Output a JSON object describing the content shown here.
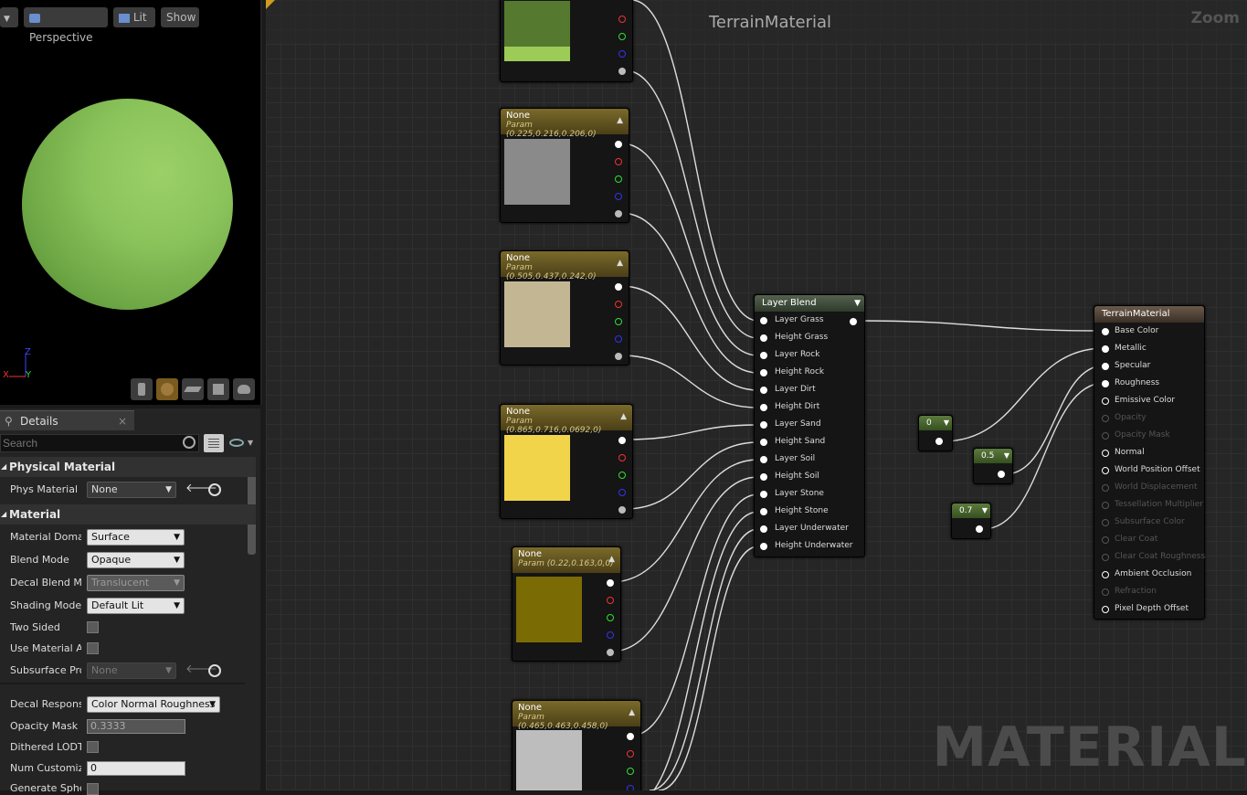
{
  "viewport": {
    "dropdown_icon": "chevron-down-icon",
    "perspective_label": "Perspective",
    "lit_label": "Lit",
    "show_label": "Show",
    "axis_z": "Z",
    "axis_x": "X",
    "axis_y": "Y"
  },
  "details": {
    "tab_label": "Details",
    "tab_close": "×",
    "search_placeholder": "Search",
    "sections": {
      "physical": "Physical Material",
      "material": "Material"
    },
    "props": {
      "phys_material": {
        "label": "Phys Material",
        "value": "None"
      },
      "material_domain": {
        "label": "Material Domai",
        "value": "Surface"
      },
      "blend_mode": {
        "label": "Blend Mode",
        "value": "Opaque"
      },
      "decal_blend": {
        "label": "Decal Blend Mo",
        "value": "Translucent"
      },
      "shading_model": {
        "label": "Shading Model",
        "value": "Default Lit"
      },
      "two_sided": {
        "label": "Two Sided"
      },
      "use_material_at": {
        "label": "Use Material At"
      },
      "subsurface": {
        "label": "Subsurface Pro",
        "value": "None"
      },
      "decal_response": {
        "label": "Decal Response",
        "value": "Color Normal Roughness"
      },
      "opacity_mask": {
        "label": "Opacity Mask C",
        "value": "0.3333"
      },
      "dithered": {
        "label": "Dithered LODTr"
      },
      "num_customized": {
        "label": "Num Customize",
        "value": "0"
      },
      "generate_sphere": {
        "label": "Generate Spher"
      }
    }
  },
  "graph": {
    "title": "TerrainMaterial",
    "zoom": "Zoom",
    "watermark": "MATERIAL",
    "param_nodes": [
      {
        "title": "None",
        "subtitle": "Param (0.225,0.216,0.206,0)",
        "color": "#8a8a8a"
      },
      {
        "title": "None",
        "subtitle": "Param (0.505,0.437,0.242,0)",
        "color": "#c3b793"
      },
      {
        "title": "None",
        "subtitle": "Param (0.865,0.716,0.0692,0)",
        "color": "#f1d44a"
      },
      {
        "title": "None",
        "subtitle": "Param (0.22,0.163,0,0)",
        "color": "#7b6b05"
      },
      {
        "title": "None",
        "subtitle": "Param (0.465,0.463,0.458,0)",
        "color": "#bdbdbd"
      }
    ],
    "top_swatch_colors": [
      "#557a2f",
      "#9ccc56"
    ],
    "layer_blend": {
      "title": "Layer Blend",
      "inputs": [
        "Layer Grass",
        "Height Grass",
        "Layer Rock",
        "Height Rock",
        "Layer Dirt",
        "Height Dirt",
        "Layer Sand",
        "Height Sand",
        "Layer Soil",
        "Height Soil",
        "Layer Stone",
        "Height Stone",
        "Layer Underwater",
        "Height Underwater"
      ]
    },
    "constants": [
      "0",
      "0.5",
      "0.7"
    ],
    "result_node": {
      "title": "TerrainMaterial",
      "inputs": [
        {
          "label": "Base Color",
          "active": true
        },
        {
          "label": "Metallic",
          "active": true
        },
        {
          "label": "Specular",
          "active": true
        },
        {
          "label": "Roughness",
          "active": true
        },
        {
          "label": "Emissive Color",
          "active": true
        },
        {
          "label": "Opacity",
          "active": false
        },
        {
          "label": "Opacity Mask",
          "active": false
        },
        {
          "label": "Normal",
          "active": true
        },
        {
          "label": "World Position Offset",
          "active": true
        },
        {
          "label": "World Displacement",
          "active": false
        },
        {
          "label": "Tessellation Multiplier",
          "active": false
        },
        {
          "label": "Subsurface Color",
          "active": false
        },
        {
          "label": "Clear Coat",
          "active": false
        },
        {
          "label": "Clear Coat Roughness",
          "active": false
        },
        {
          "label": "Ambient Occlusion",
          "active": true
        },
        {
          "label": "Refraction",
          "active": false
        },
        {
          "label": "Pixel Depth Offset",
          "active": true
        }
      ]
    }
  }
}
